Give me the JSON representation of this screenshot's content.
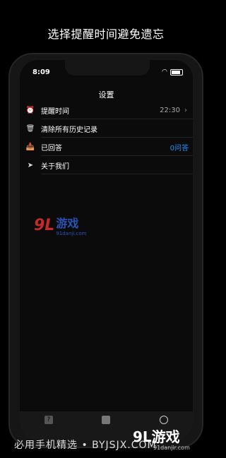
{
  "promo": {
    "title": "选择提醒时间避免遗忘"
  },
  "status": {
    "time": "8:09"
  },
  "nav": {
    "title": "设置"
  },
  "settings": {
    "items": [
      {
        "icon": "alarm-icon",
        "glyph": "⏰",
        "label": "提醒时间",
        "value": "22:30",
        "has_chevron": true
      },
      {
        "icon": "trash-icon",
        "glyph": "🗑",
        "label": "清除所有历史记录",
        "value": "",
        "has_chevron": false
      },
      {
        "icon": "inbox-icon",
        "glyph": "📥",
        "label": "已回答",
        "value": "0问答",
        "has_chevron": false
      },
      {
        "icon": "send-icon",
        "glyph": "➤",
        "label": "关于我们",
        "value": "",
        "has_chevron": false
      }
    ]
  },
  "tabs": [
    {
      "icon": "question-icon",
      "glyph": "?"
    },
    {
      "icon": "inbox-icon",
      "glyph": ""
    },
    {
      "icon": "gear-icon",
      "glyph": ""
    }
  ],
  "watermarks": {
    "center_num": "9L",
    "center_text": "游戏",
    "center_url": "91danji.com",
    "brand": "9L游戏",
    "brand_url": "91danjir.com"
  },
  "footer": {
    "text": "必用手机精选 • BYJSJX.COM"
  },
  "colors": {
    "accent": "#1e90ff",
    "background": "#000000"
  }
}
